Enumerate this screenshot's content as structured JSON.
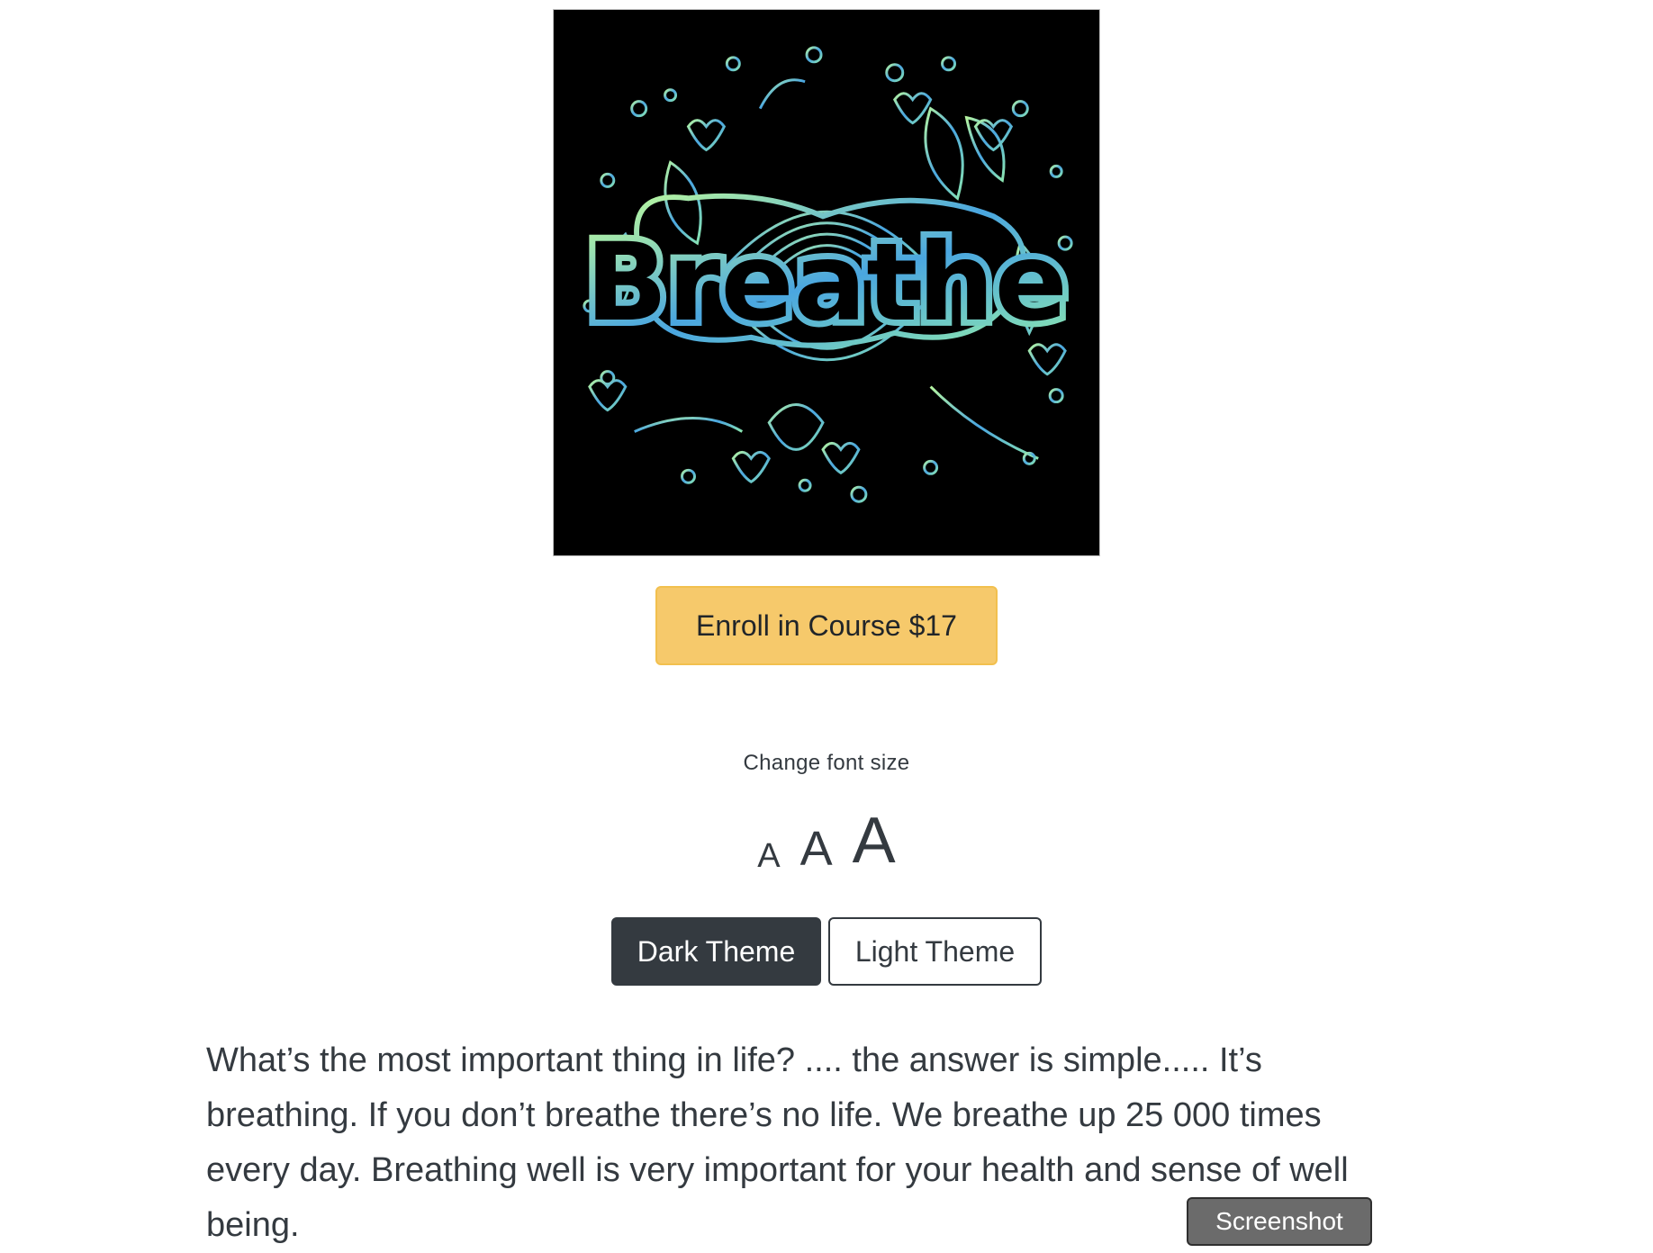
{
  "hero_image": {
    "word": "Breathe",
    "alt": "Breathe"
  },
  "enroll_button": {
    "label": "Enroll in Course $17"
  },
  "font_size": {
    "label": "Change font size",
    "small": "A",
    "medium": "A",
    "large": "A"
  },
  "theme": {
    "dark_label": "Dark Theme",
    "light_label": "Light Theme"
  },
  "intro_text": "What’s the most important thing in life? .... the answer is simple..... It’s breathing. If you don’t breathe there’s no life. We breathe up 25 000 times every day. Breathing well is very important for your health and sense of well being.",
  "tooltip": {
    "label": "Screenshot"
  },
  "colors": {
    "enroll_bg": "#f6c96b",
    "dark_button_bg": "#343a40",
    "text": "#343a40",
    "art_green": "#9ef0a8",
    "art_blue": "#3a8fd9"
  }
}
